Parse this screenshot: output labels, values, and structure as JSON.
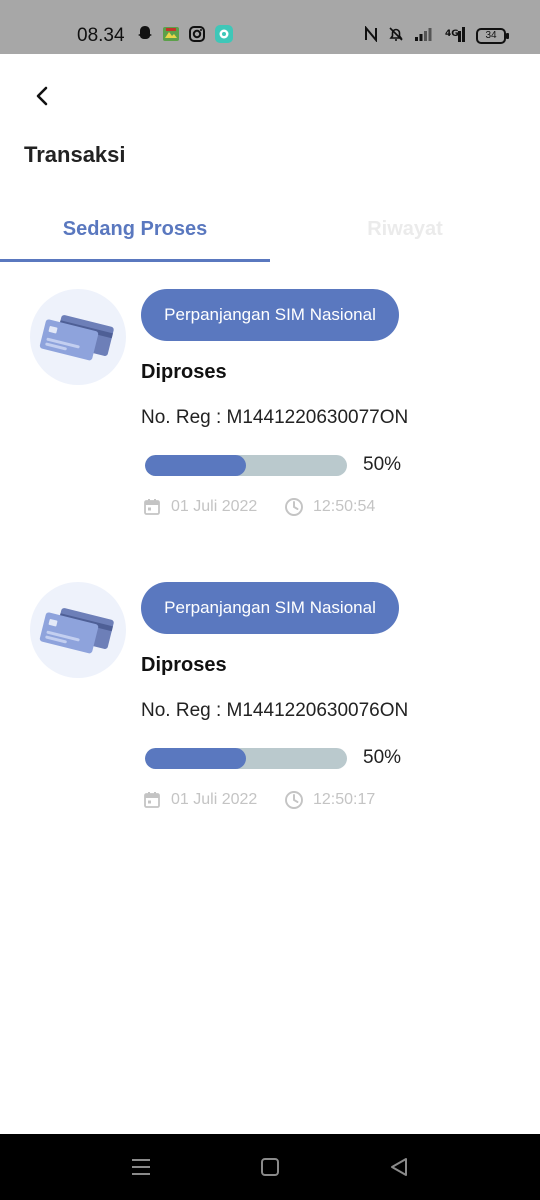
{
  "status_bar": {
    "time": "08.34",
    "network": "4G",
    "battery": "34"
  },
  "header": {
    "title": "Transaksi"
  },
  "tabs": [
    {
      "label": "Sedang Proses",
      "active": true
    },
    {
      "label": "Riwayat",
      "active": false
    }
  ],
  "transactions": [
    {
      "service": "Perpanjangan SIM Nasional",
      "status": "Diproses",
      "reg_number": "No. Reg : M1441220630077ON",
      "progress": 0.5,
      "progress_label": "50%",
      "date": "01 Juli 2022",
      "time": "12:50:54"
    },
    {
      "service": "Perpanjangan SIM Nasional",
      "status": "Diproses",
      "reg_number": "No. Reg : M1441220630076ON",
      "progress": 0.5,
      "progress_label": "50%",
      "date": "01 Juli 2022",
      "time": "12:50:17"
    }
  ],
  "colors": {
    "accent": "#5a78bf",
    "progress_track": "#bac9cd",
    "meta_text": "#c4c4c4",
    "inactive_tab": "#ebebeb"
  }
}
